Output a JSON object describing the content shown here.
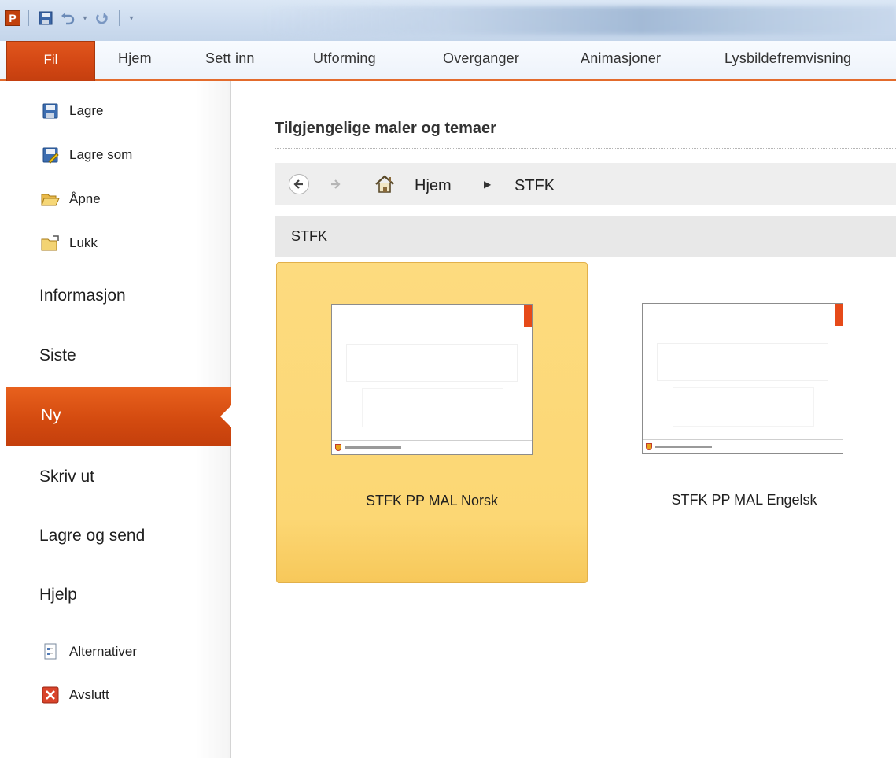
{
  "app": {
    "logo_letter": "P",
    "accent": "#D24613"
  },
  "ribbon": {
    "file_tab": "Fil",
    "tabs": [
      "Hjem",
      "Sett inn",
      "Utforming",
      "Overganger",
      "Animasjoner",
      "Lysbildefremvisning"
    ]
  },
  "backstage": {
    "commands": [
      {
        "label": "Lagre",
        "icon": "save-icon"
      },
      {
        "label": "Lagre som",
        "icon": "save-as-icon"
      },
      {
        "label": "Åpne",
        "icon": "open-folder-icon"
      },
      {
        "label": "Lukk",
        "icon": "close-folder-icon"
      }
    ],
    "categories": {
      "info": "Informasjon",
      "recent": "Siste",
      "new": "Ny",
      "print": "Skriv ut",
      "save_send": "Lagre og send",
      "help": "Hjelp"
    },
    "bottom_commands": [
      {
        "label": "Alternativer",
        "icon": "options-icon"
      },
      {
        "label": "Avslutt",
        "icon": "exit-icon"
      }
    ],
    "selected": "Ny"
  },
  "main": {
    "title": "Tilgjengelige maler og temaer",
    "breadcrumb": {
      "home": "Hjem",
      "current": "STFK"
    },
    "group_title": "STFK",
    "templates": [
      {
        "label": "STFK PP MAL Norsk",
        "selected": true
      },
      {
        "label": "STFK PP MAL Engelsk",
        "selected": false
      }
    ]
  }
}
